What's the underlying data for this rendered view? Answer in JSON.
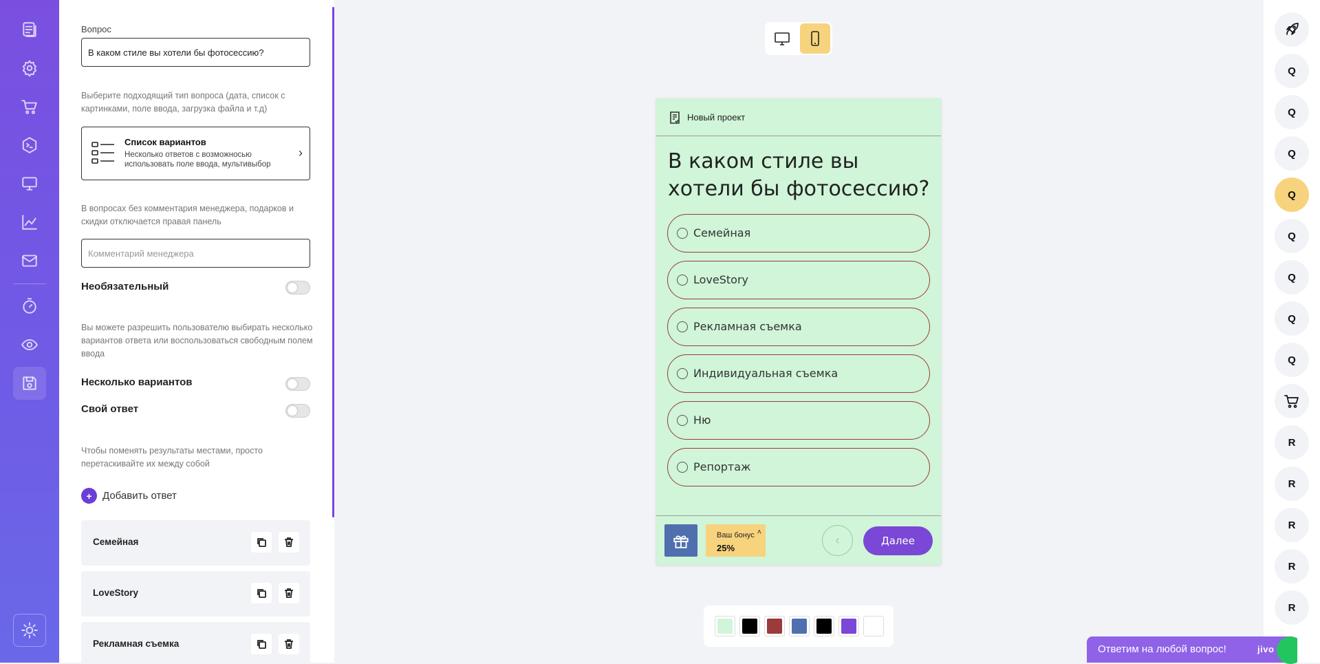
{
  "panel": {
    "question_label": "Вопрос",
    "question_value": "В каком стиле вы хотели бы фотосессию?",
    "type_hint": "Выберите подходящий тип вопроса (дата, список с картинками, поле ввода, загрузка файла и т.д)",
    "type_title": "Список вариантов",
    "type_desc": "Несколько ответов с возможносью использовать поле ввода, мультивыбор",
    "comment_hint": "В вопросах без комментария менеджера, подарков и скидки отключается правая панель",
    "comment_placeholder": "Комментарий менеджера",
    "optional_label": "Необязательный",
    "multi_hint": "Вы можете разрешить пользователю выбирать несколько вариантов ответа или воспользоваться свободным полем ввода",
    "multi_label": "Несколько вариантов",
    "own_label": "Свой ответ",
    "reorder_hint": "Чтобы поменять результаты местами, просто перетаскивайте их между собой",
    "add_answer": "Добавить ответ",
    "add_plus": "+",
    "answers": [
      "Семейная",
      "LoveStory",
      "Рекламная съемка"
    ]
  },
  "preview": {
    "project_title": "Новый проект",
    "question": "В каком стиле вы хотели бы фотосессию?",
    "options": [
      "Семейная",
      "LoveStory",
      "Рекламная съемка",
      "Индивидуальная съемка",
      "Ню",
      "Репортаж"
    ],
    "bonus_label": "Ваш бонус",
    "bonus_value": "25%",
    "back_symbol": "‹",
    "next_label": "Далее",
    "device_active": "mobile"
  },
  "palette": {
    "colors": [
      "#d0f5d8",
      "#000000",
      "#9b3b3b",
      "#4f6fae",
      "#000000",
      "#7a47d6",
      "#ffffff"
    ]
  },
  "qrail": {
    "items": [
      "rocket",
      "Q",
      "Q",
      "Q",
      "Q",
      "Q",
      "Q",
      "Q",
      "Q",
      "cart",
      "R",
      "R",
      "R",
      "R",
      "R"
    ],
    "active_index": 4
  },
  "chat": {
    "text": "Ответим на любой вопрос!",
    "brand": "jivo"
  },
  "icons": {
    "rail": [
      "quiz-list-icon",
      "settings-icon",
      "cart-icon",
      "code-icon",
      "monitor-icon",
      "analytics-icon",
      "mail-icon",
      "timer-icon",
      "eye-icon",
      "save-icon",
      "theme-sun-icon"
    ]
  }
}
